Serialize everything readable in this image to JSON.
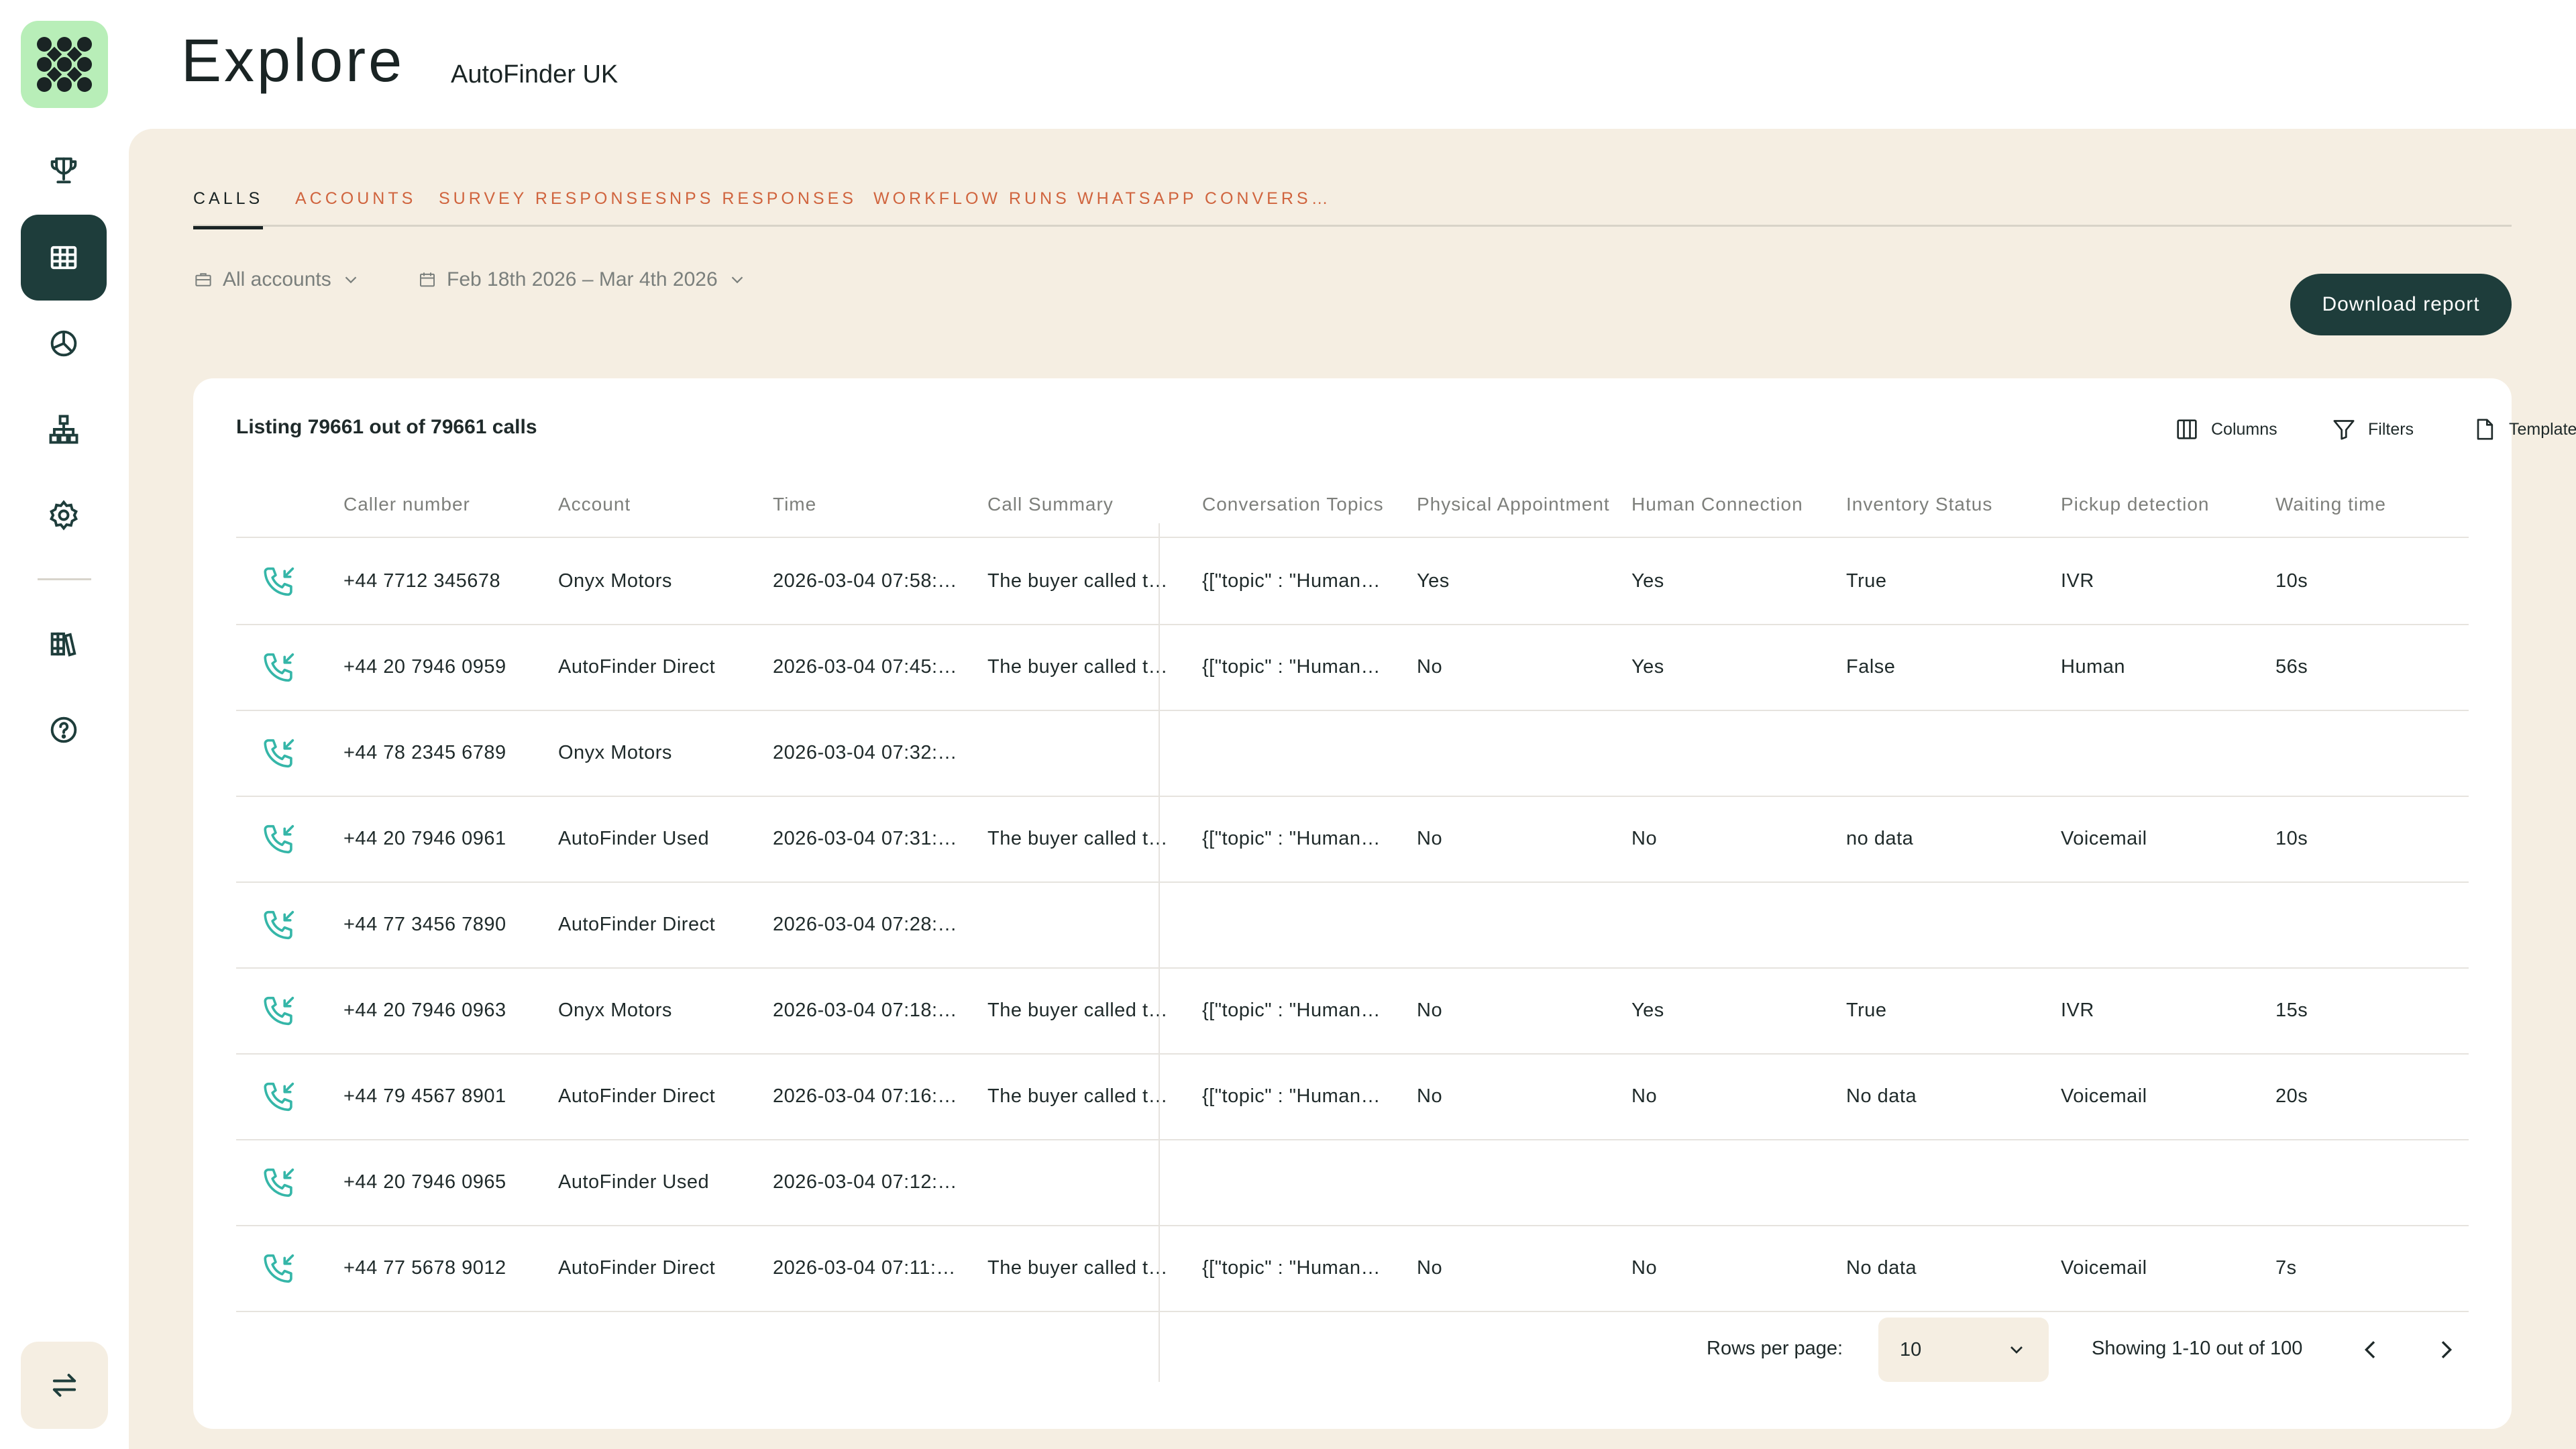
{
  "app": {
    "title": "Explore",
    "organization": "AutoFinder UK"
  },
  "sidebar": {
    "logo_icon": "grid-dots-logo-icon",
    "items": [
      {
        "name": "trophy-icon",
        "active": false
      },
      {
        "name": "table-icon",
        "active": true
      },
      {
        "name": "pie-chart-icon",
        "active": false
      },
      {
        "name": "workflow-icon",
        "active": false
      },
      {
        "name": "settings-icon",
        "active": false
      },
      {
        "name": "library-icon",
        "active": false
      },
      {
        "name": "help-icon",
        "active": false
      }
    ],
    "bottom_icon": "switch-arrows-icon"
  },
  "tabs": [
    {
      "label": "CALLS",
      "active": true
    },
    {
      "label": "ACCOUNTS",
      "active": false
    },
    {
      "label": "SURVEY RESPONSES",
      "active": false
    },
    {
      "label": "NPS RESPONSES",
      "active": false
    },
    {
      "label": "WORKFLOW RUNS",
      "active": false
    },
    {
      "label": "WHATSAPP CONVERS…",
      "active": false
    }
  ],
  "filters": {
    "accounts": "All accounts",
    "date_range": "Feb 18th 2026 – Mar 4th 2026"
  },
  "download_label": "Download report",
  "table": {
    "listing_text": "Listing 79661 out of 79661 calls",
    "toolbar": {
      "columns": "Columns",
      "filters": "Filters",
      "templates": "Templates"
    },
    "columns": [
      "Caller number",
      "Account",
      "Time",
      "Call Summary",
      "Conversation Topics",
      "Physical Appointment",
      "Human Connection",
      "Inventory Status",
      "Pickup detection",
      "Waiting time"
    ],
    "rows": [
      [
        "+44 7712 345678",
        "Onyx Motors",
        "2026-03-04 07:58:…",
        "The buyer called t…",
        "{[\"topic\" : \"Human…",
        "Yes",
        "Yes",
        "True",
        "IVR",
        "10s"
      ],
      [
        "+44 20 7946 0959",
        "AutoFinder Direct",
        "2026-03-04 07:45:…",
        "The buyer called t…",
        "{[\"topic\" : \"Human…",
        "No",
        "Yes",
        "False",
        "Human",
        "56s"
      ],
      [
        "+44 78 2345 6789",
        "Onyx Motors",
        "2026-03-04 07:32:…",
        "",
        "",
        "",
        "",
        "",
        "",
        ""
      ],
      [
        "+44 20 7946 0961",
        "AutoFinder Used",
        "2026-03-04 07:31:…",
        "The buyer called t…",
        "{[\"topic\" : \"Human…",
        "No",
        "No",
        "no data",
        "Voicemail",
        "10s"
      ],
      [
        "+44 77 3456 7890",
        "AutoFinder Direct",
        "2026-03-04 07:28:…",
        "",
        "",
        "",
        "",
        "",
        "",
        ""
      ],
      [
        "+44 20 7946 0963",
        "Onyx Motors",
        "2026-03-04 07:18:…",
        "The buyer called t…",
        "{[\"topic\" : \"Human…",
        "No",
        "Yes",
        "True",
        "IVR",
        "15s"
      ],
      [
        "+44 79 4567 8901",
        "AutoFinder Direct",
        "2026-03-04 07:16:…",
        "The buyer called t…",
        "{[\"topic\" : \"Human…",
        "No",
        "No",
        "No data",
        "Voicemail",
        "20s"
      ],
      [
        "+44 20 7946 0965",
        "AutoFinder Used",
        "2026-03-04 07:12:…",
        "",
        "",
        "",
        "",
        "",
        "",
        ""
      ],
      [
        "+44 77 5678 9012",
        "AutoFinder Direct",
        "2026-03-04 07:11:…",
        "The buyer called t…",
        "{[\"topic\" : \"Human…",
        "No",
        "No",
        "No data",
        "Voicemail",
        "7s"
      ]
    ],
    "row_icon": "incoming-call-icon"
  },
  "pagination": {
    "rows_per_page_label": "Rows per page:",
    "rows_per_page_value": "10",
    "showing": "Showing 1-10 out of 100"
  },
  "colors": {
    "accent_dark": "#1e3d3b",
    "tab_inactive": "#d0643e",
    "panel_bg": "#f5eee2",
    "logo_bg": "#b8eeb8",
    "call_icon": "#35b6a8"
  }
}
